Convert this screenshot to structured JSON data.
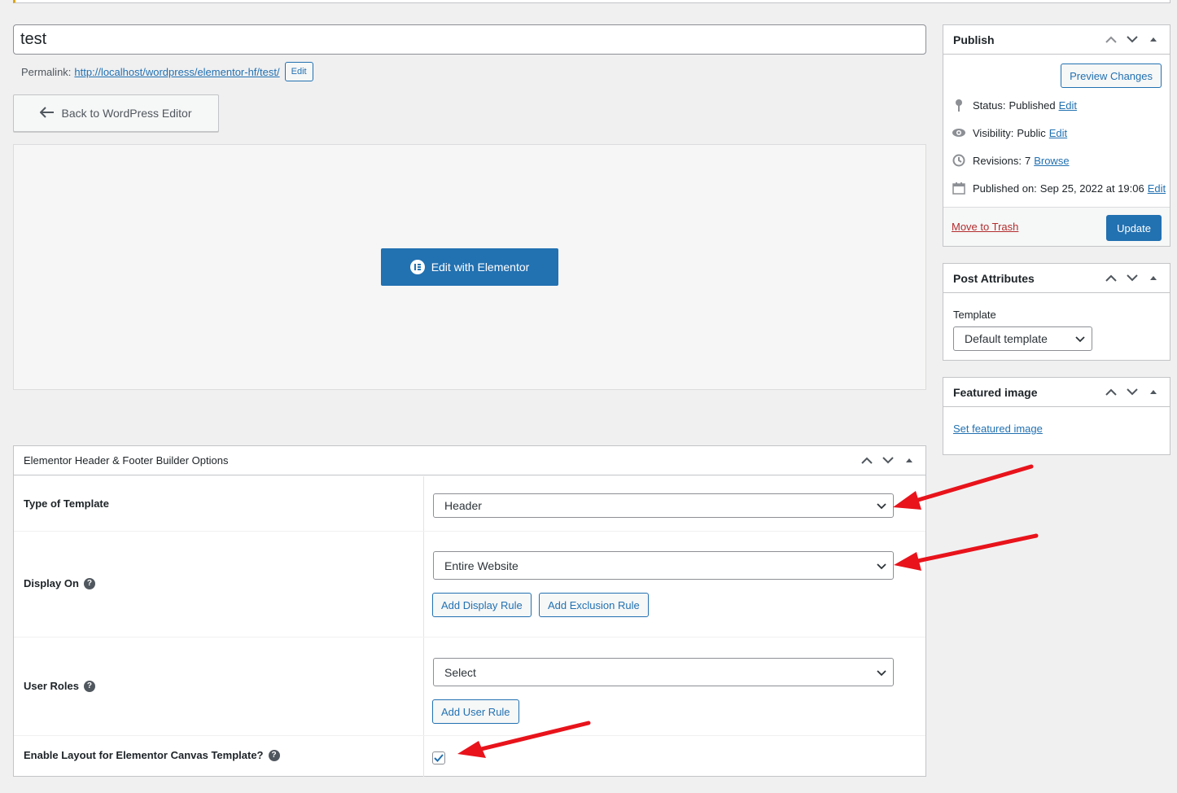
{
  "post": {
    "title": "test",
    "permalink_label": "Permalink:",
    "permalink_url": "http://localhost/wordpress/elementor-hf/test/",
    "permalink_edit": "Edit"
  },
  "editor": {
    "back_label": "Back to WordPress Editor",
    "elementor_label": "Edit with Elementor"
  },
  "publish": {
    "title": "Publish",
    "preview": "Preview Changes",
    "status_label": "Status:",
    "status_value": "Published",
    "visibility_label": "Visibility:",
    "visibility_value": "Public",
    "revisions_label": "Revisions:",
    "revisions_value": "7",
    "revisions_link": "Browse",
    "published_label": "Published on:",
    "published_value": "Sep 25, 2022 at 19:06",
    "edit": "Edit",
    "trash": "Move to Trash",
    "update": "Update"
  },
  "attributes": {
    "title": "Post Attributes",
    "template_label": "Template",
    "template_value": "Default template"
  },
  "featured": {
    "title": "Featured image",
    "link": "Set featured image"
  },
  "options": {
    "title": "Elementor Header & Footer Builder Options",
    "type_label": "Type of Template",
    "type_value": "Header",
    "display_label": "Display On",
    "display_value": "Entire Website",
    "add_display": "Add Display Rule",
    "add_exclusion": "Add Exclusion Rule",
    "roles_label": "User Roles",
    "roles_value": "Select",
    "add_user_rule": "Add User Rule",
    "canvas_label": "Enable Layout for Elementor Canvas Template?",
    "canvas_checked": true
  },
  "colors": {
    "primary": "#2271b1",
    "danger": "#b32d2e",
    "annotation": "#e8131b"
  }
}
